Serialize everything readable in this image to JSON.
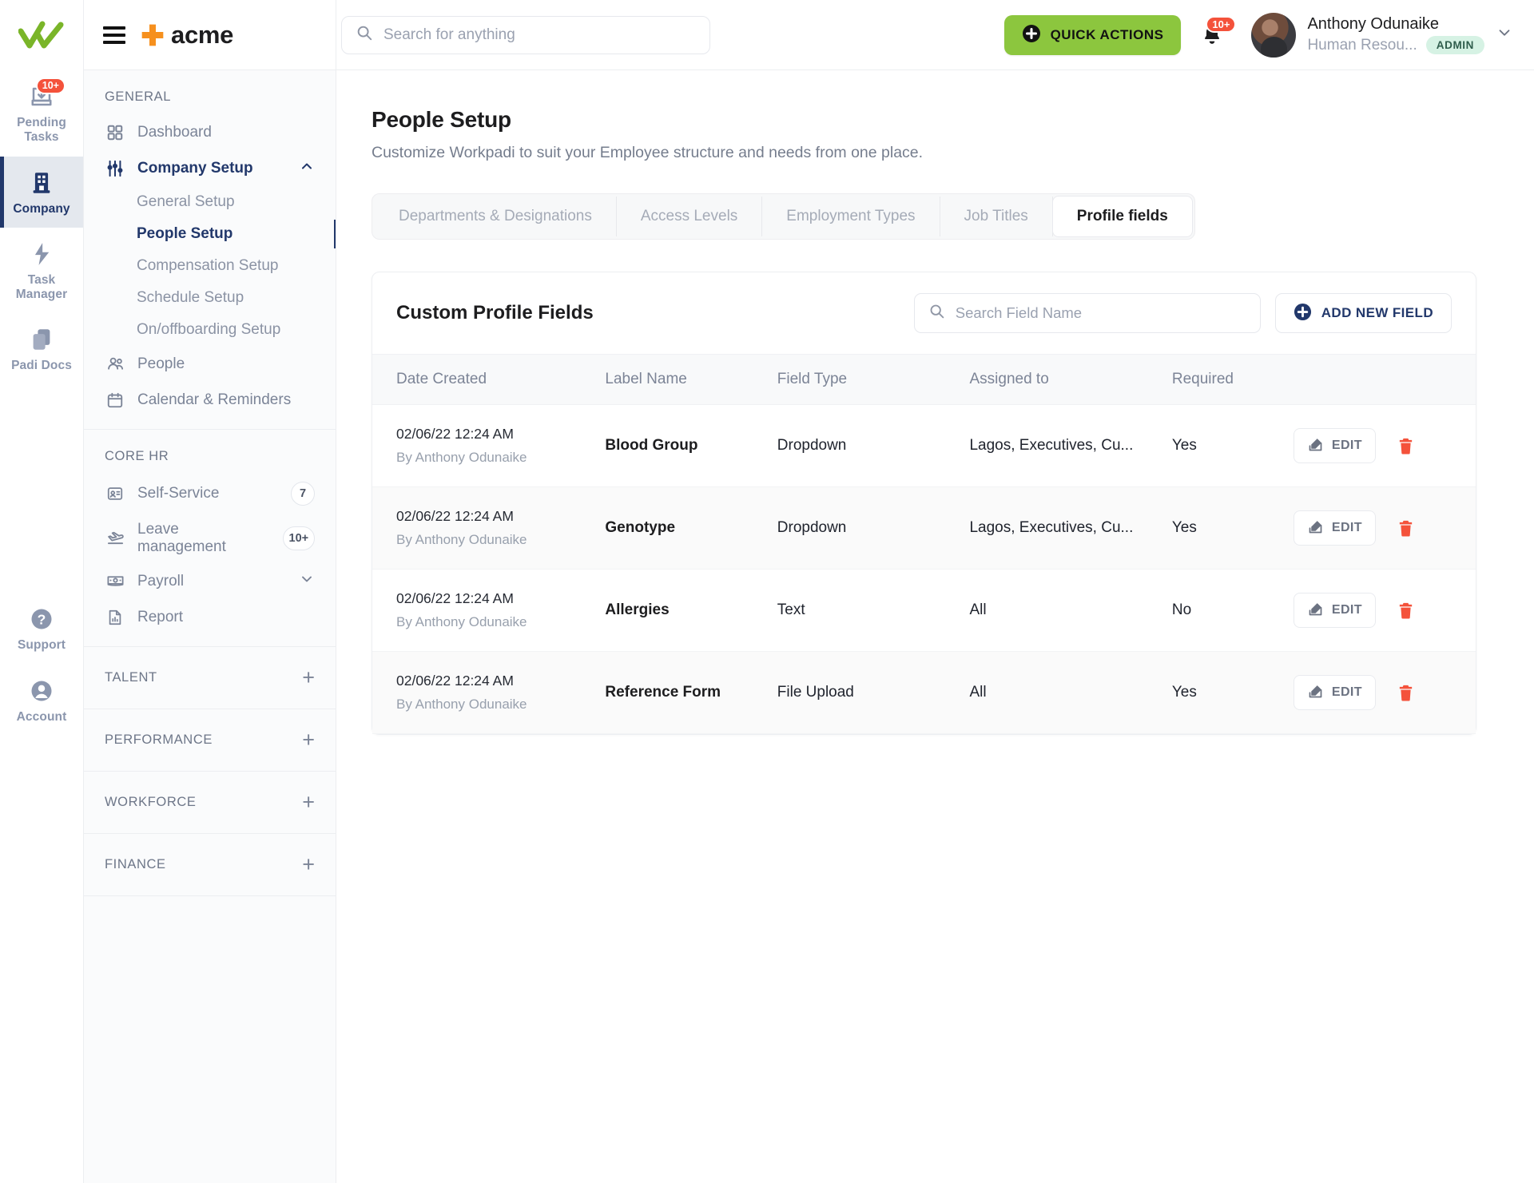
{
  "brand": {
    "name": "acme",
    "logo_icon": "acme-cross-logo",
    "app_logo_icon": "double-check-logo",
    "menu_icon": "hamburger-menu-icon"
  },
  "topbar": {
    "search": {
      "placeholder": "Search for anything",
      "value": "",
      "icon": "search-icon"
    },
    "quick_actions": {
      "label": "QUICK ACTIONS",
      "icon": "plus-circle-icon",
      "color": "#8cc63e"
    },
    "notifications": {
      "badge": "10+",
      "icon": "bell-icon",
      "badge_color": "#f4523b"
    },
    "user": {
      "name": "Anthony Odunaike",
      "role": "Human Resou...",
      "chip": "ADMIN",
      "chip_color": "#d6f2e4",
      "avatar_icon": "user-avatar",
      "caret_icon": "chevron-down-icon"
    }
  },
  "rail": {
    "items": [
      {
        "label": "Pending Tasks",
        "icon": "inbox-download-icon",
        "badge": "10+",
        "active": false
      },
      {
        "label": "Company",
        "icon": "building-icon",
        "badge": "",
        "active": true
      },
      {
        "label": "Task Manager",
        "icon": "bolt-icon",
        "badge": "",
        "active": false
      },
      {
        "label": "Padi Docs",
        "icon": "documents-icon",
        "badge": "",
        "active": false
      }
    ],
    "bottom": [
      {
        "label": "Support",
        "icon": "question-circle-icon",
        "active": false
      },
      {
        "label": "Account",
        "icon": "account-circle-icon",
        "active": false
      }
    ]
  },
  "sidebar": {
    "general": {
      "title": "GENERAL",
      "items": [
        {
          "label": "Dashboard",
          "icon": "grid-icon"
        },
        {
          "label": "Company Setup",
          "icon": "sliders-icon",
          "expanded": true,
          "chevron": "chevron-up-icon"
        }
      ],
      "sub_items": [
        {
          "label": "General Setup",
          "active": false
        },
        {
          "label": "People Setup",
          "active": true
        },
        {
          "label": "Compensation Setup",
          "active": false
        },
        {
          "label": "Schedule Setup",
          "active": false
        },
        {
          "label": "On/offboarding Setup",
          "active": false
        }
      ],
      "items_after": [
        {
          "label": "People",
          "icon": "people-icon"
        },
        {
          "label": "Calendar & Reminders",
          "icon": "calendar-icon"
        }
      ]
    },
    "core_hr": {
      "title": "CORE HR",
      "items": [
        {
          "label": "Self-Service",
          "icon": "id-card-icon",
          "count": "7"
        },
        {
          "label": "Leave management",
          "icon": "plane-icon",
          "count": "10+"
        },
        {
          "label": "Payroll",
          "icon": "money-icon",
          "chevron": "chevron-down-icon"
        },
        {
          "label": "Report",
          "icon": "report-icon"
        }
      ]
    },
    "collapsed_sections": [
      {
        "title": "TALENT",
        "icon": "plus-icon"
      },
      {
        "title": "PERFORMANCE",
        "icon": "plus-icon"
      },
      {
        "title": "WORKFORCE",
        "icon": "plus-icon"
      },
      {
        "title": "FINANCE",
        "icon": "plus-icon"
      }
    ]
  },
  "page": {
    "title": "People Setup",
    "subtitle": "Customize Workpadi to suit your Employee structure and needs from one place.",
    "tabs": [
      {
        "label": "Departments & Designations",
        "active": false
      },
      {
        "label": "Access Levels",
        "active": false
      },
      {
        "label": "Employment Types",
        "active": false
      },
      {
        "label": "Job Titles",
        "active": false
      },
      {
        "label": "Profile fields",
        "active": true
      }
    ]
  },
  "card": {
    "title": "Custom Profile Fields",
    "search": {
      "placeholder": "Search Field Name",
      "value": "",
      "icon": "search-icon"
    },
    "add_button": {
      "label": "ADD NEW FIELD",
      "icon": "plus-circle-icon"
    },
    "columns": [
      "Date Created",
      "Label Name",
      "Field Type",
      "Assigned to",
      "Required",
      ""
    ],
    "row_actions": {
      "edit_label": "EDIT",
      "edit_icon": "edit-pencil-icon",
      "delete_icon": "trash-icon",
      "delete_color": "#f4523b"
    },
    "rows": [
      {
        "date": "02/06/22 12:24 AM",
        "by": "By Anthony Odunaike",
        "label": "Blood Group",
        "type": "Dropdown",
        "assigned": "Lagos, Executives, Cu...",
        "required": "Yes"
      },
      {
        "date": "02/06/22 12:24 AM",
        "by": "By Anthony Odunaike",
        "label": "Genotype",
        "type": "Dropdown",
        "assigned": "Lagos, Executives, Cu...",
        "required": "Yes"
      },
      {
        "date": "02/06/22 12:24 AM",
        "by": "By Anthony Odunaike",
        "label": "Allergies",
        "type": "Text",
        "assigned": "All",
        "required": "No"
      },
      {
        "date": "02/06/22 12:24 AM",
        "by": "By Anthony Odunaike",
        "label": "Reference Form",
        "type": "File Upload",
        "assigned": "All",
        "required": "Yes"
      }
    ]
  }
}
